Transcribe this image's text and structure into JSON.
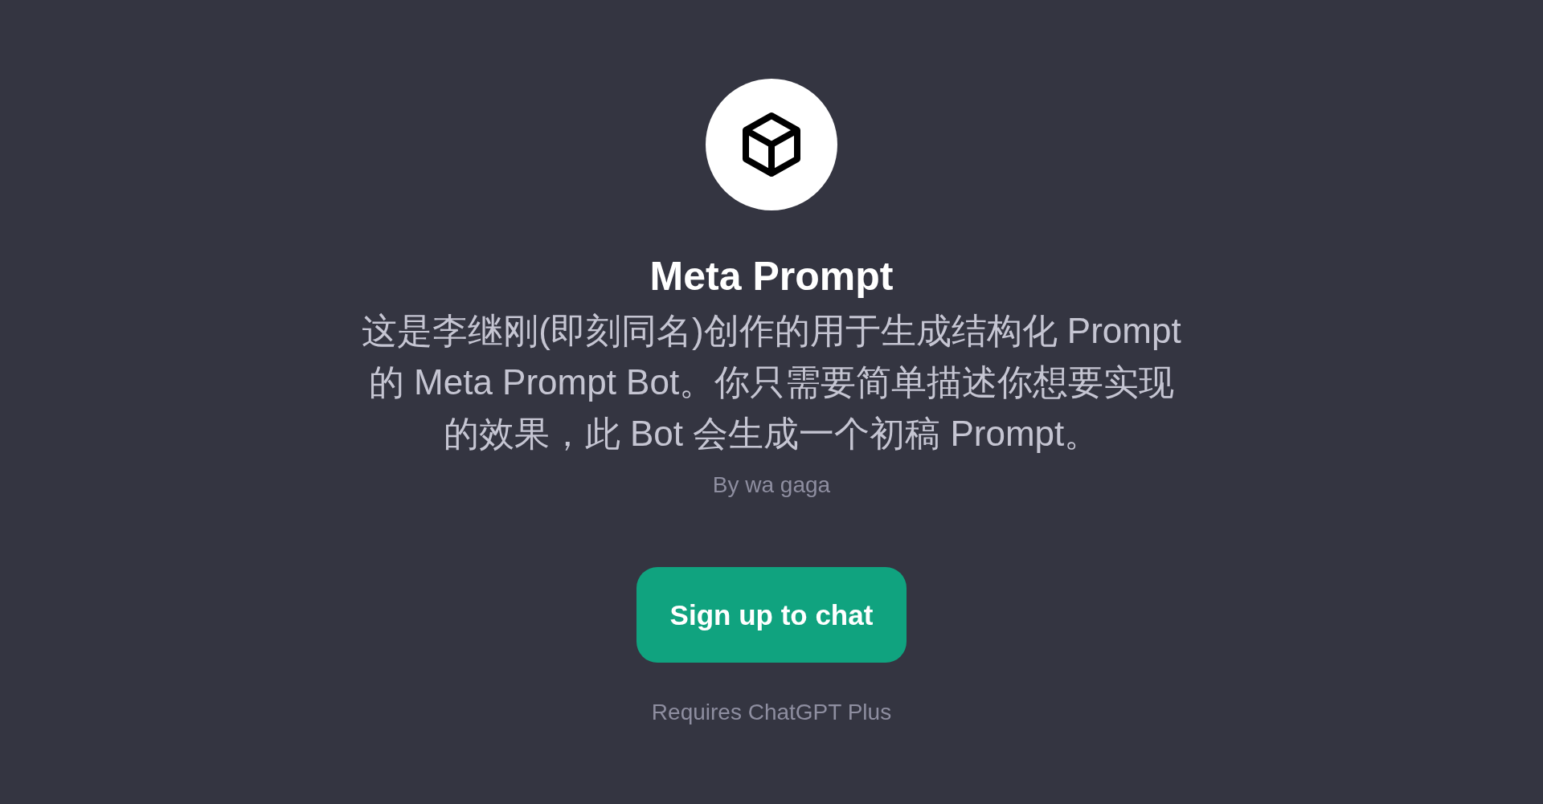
{
  "gpt": {
    "title": "Meta Prompt",
    "description": "这是李继刚(即刻同名)创作的用于生成结构化 Prompt 的 Meta Prompt Bot。你只需要简单描述你想要实现的效果，此 Bot 会生成一个初稿 Prompt。",
    "author": "By wa gaga"
  },
  "button": "Sign up to chat",
  "note": "Requires ChatGPT Plus"
}
